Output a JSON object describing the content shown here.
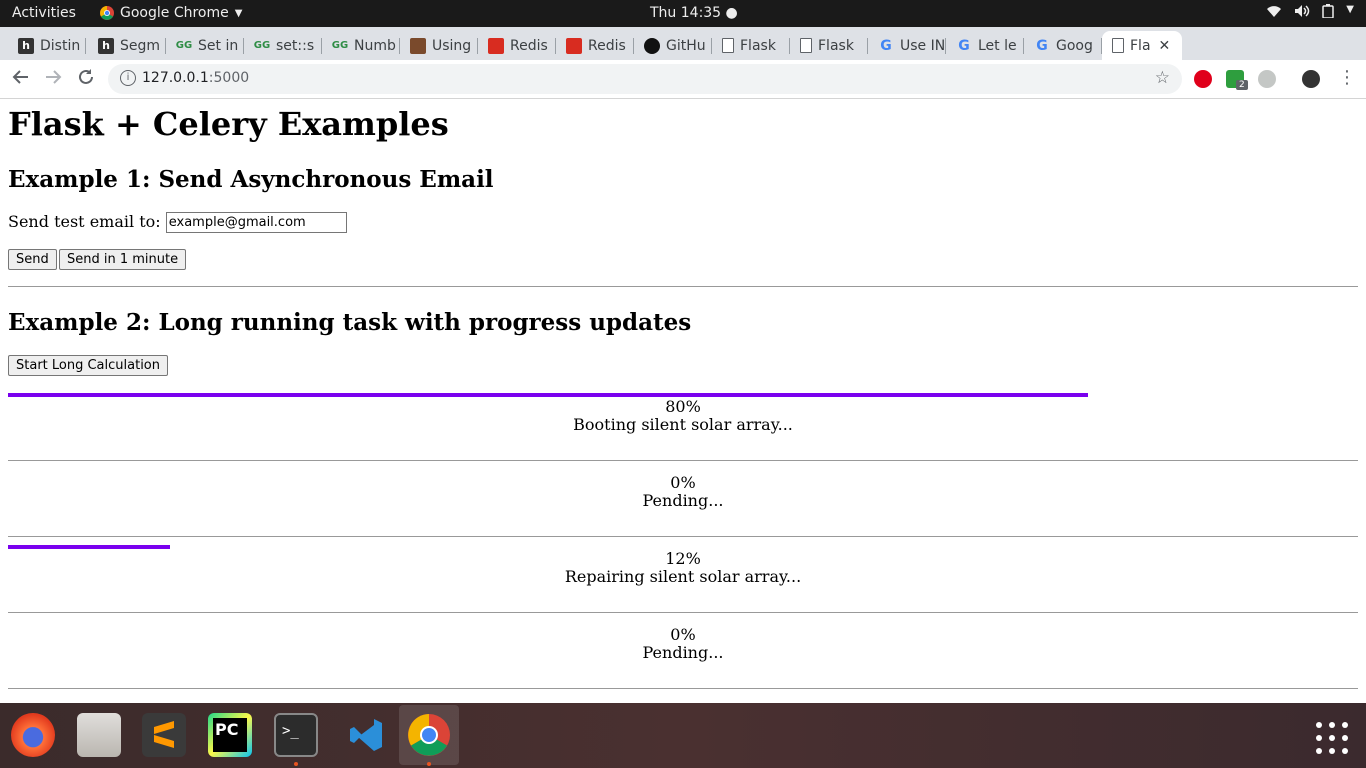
{
  "topbar": {
    "activities": "Activities",
    "app_name": "Google Chrome",
    "clock": "Thu 14:35 ●"
  },
  "tabs": [
    {
      "title": "Distin",
      "icon": "hackernoon-icon"
    },
    {
      "title": "Segm",
      "icon": "hackernoon-icon"
    },
    {
      "title": "Set in",
      "icon": "geeksforgeeks-icon"
    },
    {
      "title": "set::s",
      "icon": "geeksforgeeks-icon"
    },
    {
      "title": "Numb",
      "icon": "geeksforgeeks-icon"
    },
    {
      "title": "Using",
      "icon": "photo-icon"
    },
    {
      "title": "Redis",
      "icon": "redis-icon"
    },
    {
      "title": "Redis",
      "icon": "redis-icon"
    },
    {
      "title": "GitHu",
      "icon": "github-icon"
    },
    {
      "title": "Flask",
      "icon": "document-icon"
    },
    {
      "title": "Flask",
      "icon": "document-icon"
    },
    {
      "title": "Use IN",
      "icon": "google-icon"
    },
    {
      "title": "Let le",
      "icon": "google-icon"
    },
    {
      "title": "Goog",
      "icon": "google-icon"
    },
    {
      "title": "Fla",
      "icon": "document-icon",
      "active": true
    }
  ],
  "toolbar": {
    "url_host": "127.0.0.1",
    "url_port": ":5000",
    "extension_badge": "2"
  },
  "page": {
    "title": "Flask + Celery Examples",
    "example1": {
      "heading": "Example 1: Send Asynchronous Email",
      "label": "Send test email to:",
      "email_value": "example@gmail.com",
      "send_label": "Send",
      "send_later_label": "Send in 1 minute"
    },
    "example2": {
      "heading": "Example 2: Long running task with progress updates",
      "start_label": "Start Long Calculation",
      "tasks": [
        {
          "percent": "80%",
          "status": "Booting silent solar array...",
          "progress": 0.8
        },
        {
          "percent": "0%",
          "status": "Pending...",
          "progress": 0.0
        },
        {
          "percent": "12%",
          "status": "Repairing silent solar array...",
          "progress": 0.12
        },
        {
          "percent": "0%",
          "status": "Pending...",
          "progress": 0.0
        }
      ]
    }
  },
  "colors": {
    "progress_bar": "#7a00ee"
  }
}
